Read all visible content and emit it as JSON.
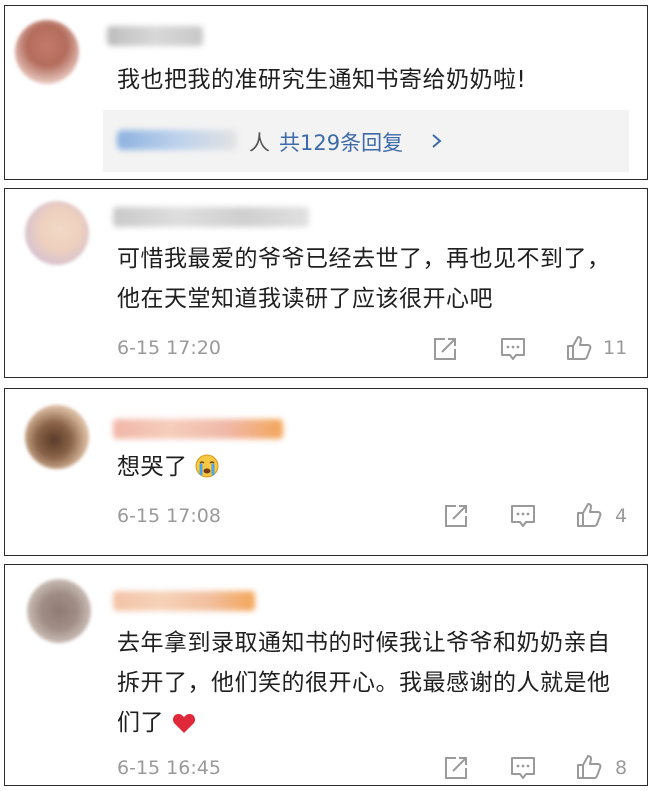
{
  "comments": [
    {
      "text": "我也把我的准研究生通知书寄给奶奶啦!",
      "replies": {
        "suffix": "人",
        "link": "共129条回复"
      }
    },
    {
      "text": "可惜我最爱的爷爷已经去世了，再也见不到了，他在天堂知道我读研了应该很开心吧",
      "time": "6-15 17:20",
      "likes": "11"
    },
    {
      "text": "想哭了",
      "emoji": "crying-face-emoji",
      "time": "6-15 17:08",
      "likes": "4"
    },
    {
      "text": "去年拿到录取通知书的时候我让爷爷和奶奶亲自拆开了，他们笑的很开心。我最感谢的人就是他们了",
      "emoji": "red-heart-emoji",
      "time": "6-15 16:45",
      "likes": "8"
    }
  ],
  "colors": {
    "link": "#3d6aa8",
    "meta": "#9a9a9a",
    "text": "#1f1f1f",
    "heart": "#e0283a"
  }
}
